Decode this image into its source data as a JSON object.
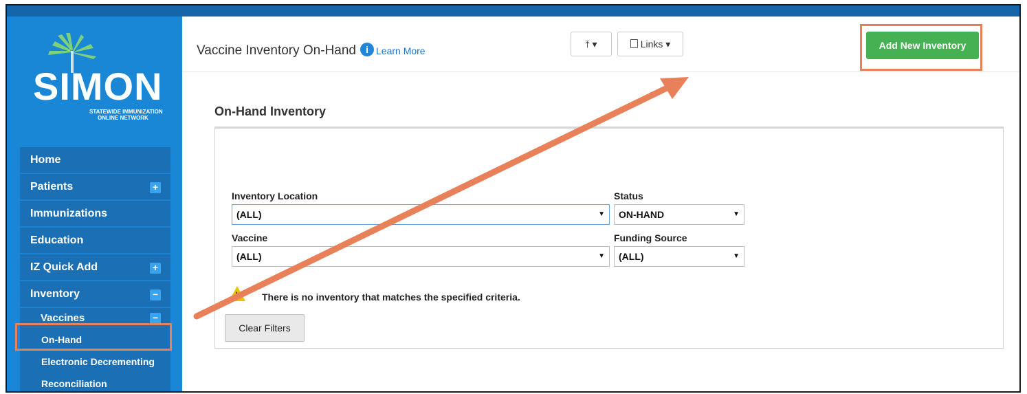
{
  "header": {
    "page_title": "Vaccine Inventory On-Hand",
    "learn_more": "Learn More",
    "info_icon": "i",
    "upload_btn": "⤒ ▾",
    "links_btn": "Links ▾",
    "add_inventory_btn": "Add New Inventory"
  },
  "logo": {
    "name": "SIMON",
    "tagline_1": "STATEWIDE IMMUNIZATION",
    "tagline_2": "ONLINE NETWORK"
  },
  "sidebar": {
    "items": [
      {
        "label": "Home"
      },
      {
        "label": "Patients",
        "toggle": "+"
      },
      {
        "label": "Immunizations"
      },
      {
        "label": "Education"
      },
      {
        "label": "IZ Quick Add",
        "toggle": "+"
      },
      {
        "label": "Inventory",
        "toggle": "−"
      }
    ],
    "sub_label": "Vaccines",
    "sub_toggle": "−",
    "subsub": [
      "On-Hand",
      "Electronic Decrementing",
      "Reconciliation"
    ]
  },
  "section": {
    "title": "On-Hand Inventory",
    "inventory_location_label": "Inventory Location",
    "inventory_location_value": "(ALL)",
    "status_label": "Status",
    "status_value": "ON-HAND",
    "vaccine_label": "Vaccine",
    "vaccine_value": "(ALL)",
    "funding_label": "Funding Source",
    "funding_value": "(ALL)",
    "warning_text": "There is no inventory that matches the specified criteria.",
    "clear_filters": "Clear Filters"
  },
  "colors": {
    "sidebar": "#1a86d6",
    "nav": "#1b70b5",
    "topbar": "#1565a8",
    "add_button": "#45b152",
    "highlight": "#e8815a"
  }
}
